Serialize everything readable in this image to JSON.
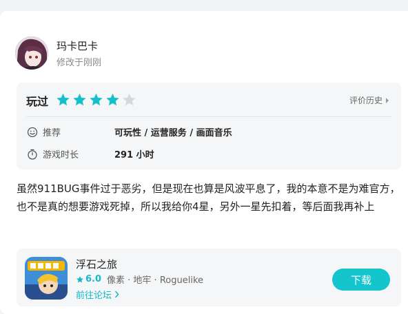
{
  "user": {
    "name": "玛卡巴卡",
    "edited": "修改于刚刚"
  },
  "rating": {
    "label": "玩过",
    "stars": 4,
    "max_stars": 5,
    "history_label": "评价历史",
    "star_color": "#14c0c9",
    "recommend_label": "推荐",
    "recommend_value": "可玩性 / 运营服务 / 画面音乐",
    "playtime_label": "游戏时长",
    "playtime_value": "291 小时"
  },
  "review": {
    "text": "虽然911BUG事件过于恶劣，但是现在也算是风波平息了，我的本意不是为难官方，也不是真的想要游戏死掉，所以我给你4星，另外一星先扣着，等后面我再补上"
  },
  "game": {
    "name": "浮石之旅",
    "score": "6.0",
    "tags": "像素 · 地牢 · Roguelike",
    "forum_label": "前往论坛",
    "download_label": "下载",
    "accent": "#15c5ce"
  }
}
